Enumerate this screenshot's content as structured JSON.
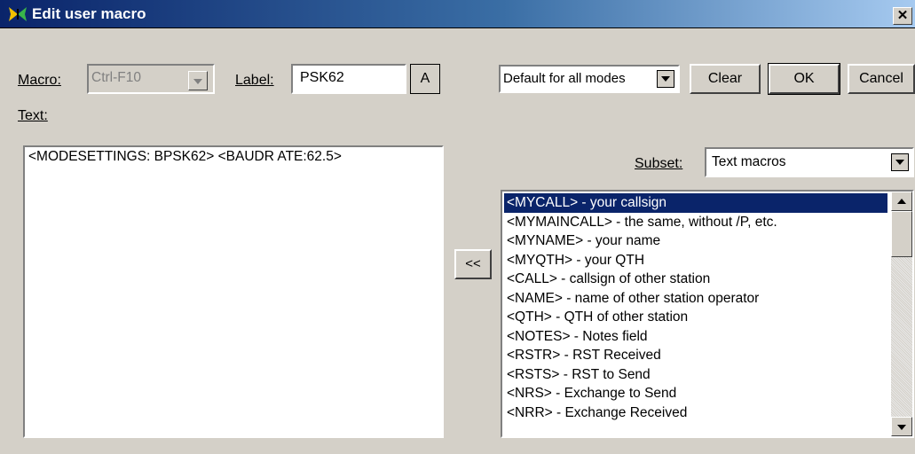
{
  "window": {
    "title": "Edit user macro",
    "close_glyph": "✕"
  },
  "macro": {
    "label": "Macro:",
    "value": "Ctrl-F10"
  },
  "label_field": {
    "label": "Label:",
    "value": "PSK62",
    "font_button": "A"
  },
  "text_area": {
    "label": "Text:",
    "value": "<MODESETTINGS: BPSK62> <BAUDR ATE:62.5>"
  },
  "mode_select": {
    "value": "Default for all modes"
  },
  "buttons": {
    "clear": "Clear",
    "ok": "OK",
    "cancel": "Cancel",
    "insert": "<<"
  },
  "subset": {
    "label": "Subset:",
    "value": "Text macros"
  },
  "macro_list": [
    "<MYCALL> - your callsign",
    "<MYMAINCALL> - the same, without /P, etc.",
    "<MYNAME> - your name",
    "<MYQTH> - your QTH",
    "<CALL> - callsign of other station",
    "<NAME> - name of other station operator",
    "<QTH> - QTH of other station",
    "<NOTES> - Notes field",
    "<RSTR> - RST Received",
    "<RSTS> - RST to Send",
    "<NRS> - Exchange to Send",
    "<NRR> - Exchange Received"
  ],
  "selected_index": 0,
  "colors": {
    "title_start": "#0a246a",
    "title_end": "#a6caf0",
    "selection": "#0a246a",
    "face": "#d4d0c8"
  },
  "icons": {
    "title": "butterfly-icon",
    "dropdown": "chevron-down-icon",
    "scroll_up": "arrow-up-icon",
    "scroll_down": "arrow-down-icon"
  }
}
